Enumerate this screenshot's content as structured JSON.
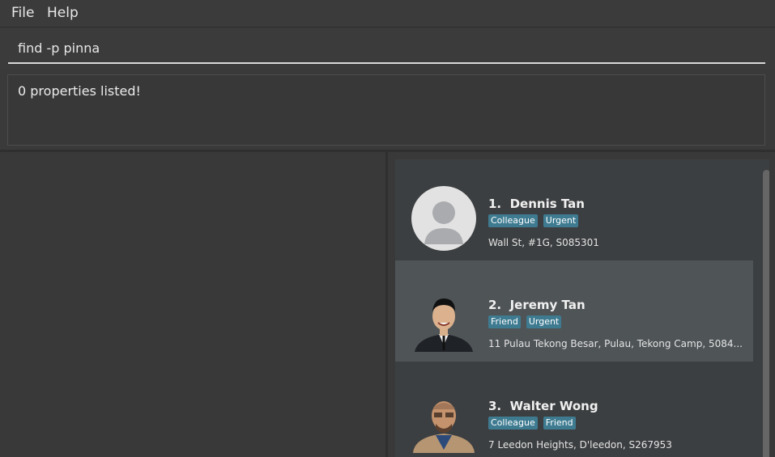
{
  "menu": {
    "file": "File",
    "help": "Help"
  },
  "command": {
    "value": "find -p pinna"
  },
  "result": {
    "message": "0 properties listed!"
  },
  "persons": [
    {
      "index": "1.",
      "name": "Dennis Tan",
      "tags": [
        "Colleague",
        "Urgent"
      ],
      "address": "Wall St, #1G, S085301",
      "avatar": "default-avatar-icon"
    },
    {
      "index": "2.",
      "name": "Jeremy Tan",
      "tags": [
        "Friend",
        "Urgent"
      ],
      "address": "11 Pulau Tekong Besar, Pulau, Tekong Camp, 5084...",
      "avatar": "photo"
    },
    {
      "index": "3.",
      "name": "Walter Wong",
      "tags": [
        "Colleague",
        "Friend"
      ],
      "address": "7 Leedon Heights, D'leedon, S267953",
      "avatar": "photo"
    }
  ],
  "colors": {
    "tag": "#3e7b91",
    "selected_card": "#4f5457",
    "card": "#3c3f41"
  }
}
